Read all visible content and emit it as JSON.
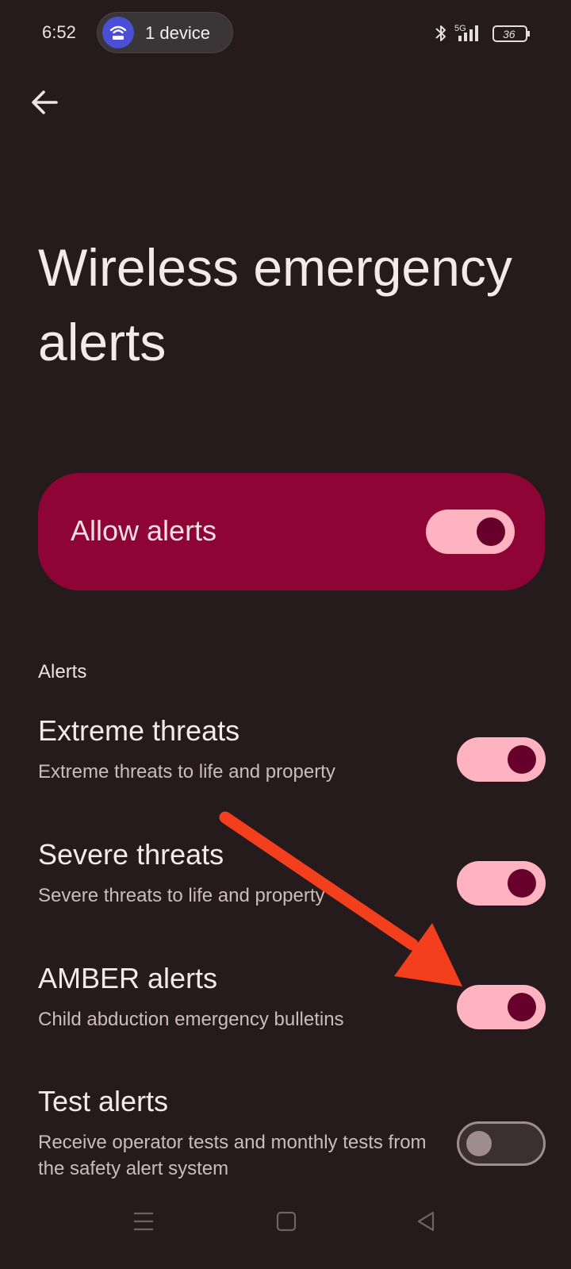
{
  "status_bar": {
    "time": "6:52",
    "hotspot_label": "1 device",
    "network": "5G",
    "battery": "36"
  },
  "page": {
    "title": "Wireless emergency alerts"
  },
  "master_toggle": {
    "label": "Allow alerts",
    "state": "on"
  },
  "section": {
    "header": "Alerts"
  },
  "prefs": [
    {
      "title": "Extreme threats",
      "summary": "Extreme threats to life and property",
      "state": "on"
    },
    {
      "title": "Severe threats",
      "summary": "Severe threats to life and property",
      "state": "on"
    },
    {
      "title": "AMBER alerts",
      "summary": "Child abduction emergency bulletins",
      "state": "on"
    },
    {
      "title": "Test alerts",
      "summary": "Receive operator tests and monthly tests from the safety alert system",
      "state": "off"
    }
  ],
  "annotation": {
    "arrow_color": "#f33f1e",
    "points_to": "AMBER alerts"
  },
  "colors": {
    "background": "#251a1c",
    "card": "#8e0435",
    "toggle_track_on": "#ffb2c0",
    "toggle_thumb_on": "#67002a"
  },
  "nav_bar": {
    "icons": [
      "menu-icon",
      "home-icon",
      "back-triangle-icon"
    ]
  }
}
